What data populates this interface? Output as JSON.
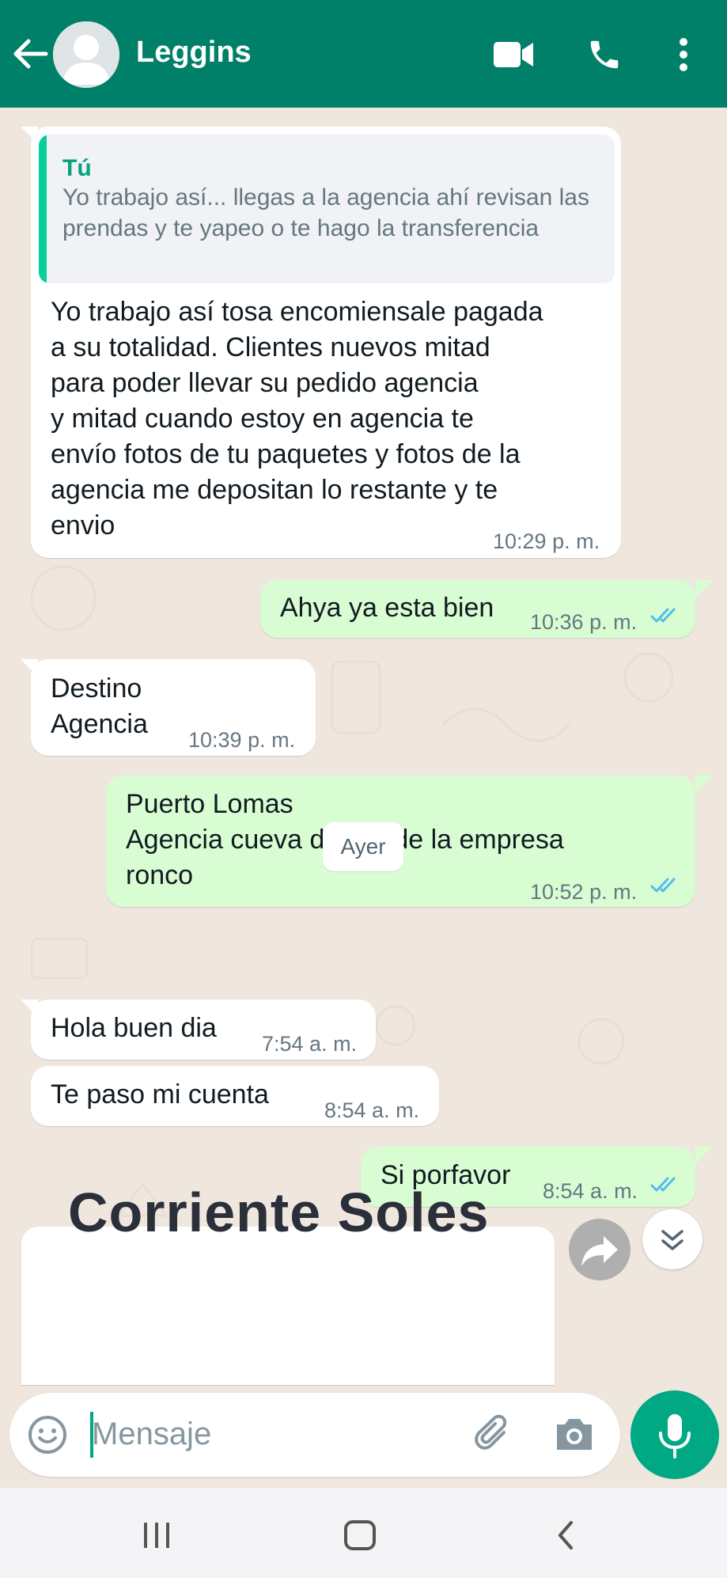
{
  "header": {
    "contact_name": "Leggins"
  },
  "messages": [
    {
      "direction": "in",
      "quote_author": "Tú",
      "quote_text": "Yo trabajo así... llegas a la agencia ahí revisan las prendas y te yapeo o te hago la transferencia",
      "text": "Yo trabajo así tosa encomiensale pagada\na su totalidad. Clientes nuevos mitad\npara poder llevar su pedido agencia\ny mitad cuando estoy en agencia te\nenvío fotos de tu paquetes y fotos de la\nagencia me depositan lo restante y te\nenvio",
      "time": "10:29 p. m."
    },
    {
      "direction": "out",
      "text": "Ahya ya esta bien",
      "time": "10:36 p. m."
    },
    {
      "direction": "in",
      "text": "Destino\nAgencia",
      "time": "10:39 p. m."
    },
    {
      "direction": "out",
      "text": "Puerto Lomas\nAgencia cueva dentro de la empresa\nronco",
      "time": "10:52 p. m."
    },
    {
      "direction": "in",
      "text": "Hola buen dia",
      "time": "7:54 a. m."
    },
    {
      "direction": "in",
      "text": "Te paso mi cuenta",
      "time": "8:54 a. m."
    },
    {
      "direction": "out",
      "text": "Si porfavor",
      "time": "8:54 a. m."
    }
  ],
  "date_separator": "Ayer",
  "document_preview": {
    "text": "Corriente Soles"
  },
  "composer": {
    "placeholder": "Mensaje"
  },
  "colors": {
    "header": "#008069",
    "outgoing_bubble": "#d9fdd3",
    "incoming_bubble": "#ffffff",
    "accent": "#00a884",
    "read_ticks": "#53bdeb"
  }
}
